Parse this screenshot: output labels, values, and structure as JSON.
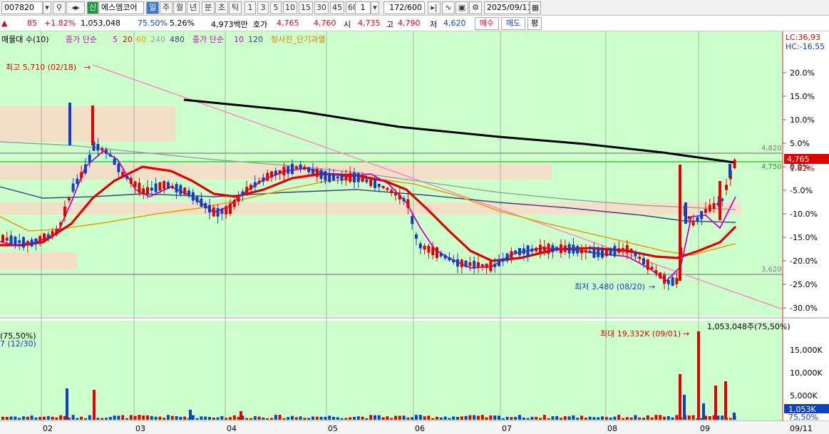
{
  "toolbar": {
    "code": "007820",
    "name": "에스엠코어",
    "badge_sin": "신",
    "periods": [
      "일",
      "주",
      "월",
      "년",
      "분",
      "초",
      "틱"
    ],
    "active_period": "일",
    "minutes": [
      "1",
      "3",
      "5",
      "10",
      "15",
      "30",
      "45",
      "60"
    ],
    "min_value": "1",
    "count": "172/600",
    "date": "2025/09/11"
  },
  "quote": {
    "change": "85",
    "change_pct": "+1.82%",
    "volume": "1,053,048",
    "vol_ratio": "75.50%",
    "turnover": "5.26%",
    "amount": "4,973백만",
    "ask_label": "호가",
    "ask1": "4,765",
    "ask2": "4,760",
    "open_label": "시",
    "open": "4,735",
    "high_label": "고",
    "high": "4,790",
    "low_label": "저",
    "low": "4,620",
    "buy": "매수",
    "sell": "매도",
    "avg": "평"
  },
  "legend": {
    "l1": "매물대 수(10)",
    "l2": "종가 단순",
    "ma": [
      "5",
      "20",
      "60",
      "240",
      "480"
    ],
    "ma_colors": [
      "#cc00cc",
      "#e00000",
      "#e8a000",
      "#a0a0a0",
      "#404080"
    ],
    "l3": "종가 단순",
    "vma": [
      "10",
      "120"
    ],
    "l4": "청사진_단기과열"
  },
  "annotations": {
    "high": "최고 5,710 (02/18)",
    "low": "최저 3,480 (08/20)",
    "vol_max": "최대 19,332K (09/01)",
    "vol_label": "1,053,048주(75,50%)",
    "vol_left1": "(75,50%)",
    "vol_left2": "7 (12/30)"
  },
  "right_axis": {
    "lc": "LC:36,93",
    "hc": "HC:-16,55",
    "ticks": [
      "20.0%",
      "15.0%",
      "10.0%",
      "5.0%",
      "0.0%",
      "-5.0%",
      "-10.0%",
      "-15.0%",
      "-20.0%",
      "-25.0%",
      "-30.0%"
    ],
    "price_now": "4,765",
    "price_now_pct": "1.82%",
    "lvl_4820": "4,820",
    "lvl_4750": "4,750",
    "lvl_3620": "3,620",
    "vol_ticks": [
      "15,000K",
      "10,000K",
      "5,000K"
    ],
    "vol_now": "1,053K",
    "vol_pct": "75,50%"
  },
  "x_axis": {
    "months": [
      "02",
      "03",
      "04",
      "05",
      "06",
      "07",
      "08",
      "09"
    ],
    "date_label": "09/11"
  },
  "chart_data": {
    "type": "candlestick",
    "y_label_unit": "%",
    "price_range": [
      3480,
      5710
    ],
    "ylim_pct": [
      -30,
      20
    ],
    "horizontal_levels": [
      4820,
      4750,
      3620
    ],
    "volume_peak": 19332,
    "last_volume": 1053
  }
}
